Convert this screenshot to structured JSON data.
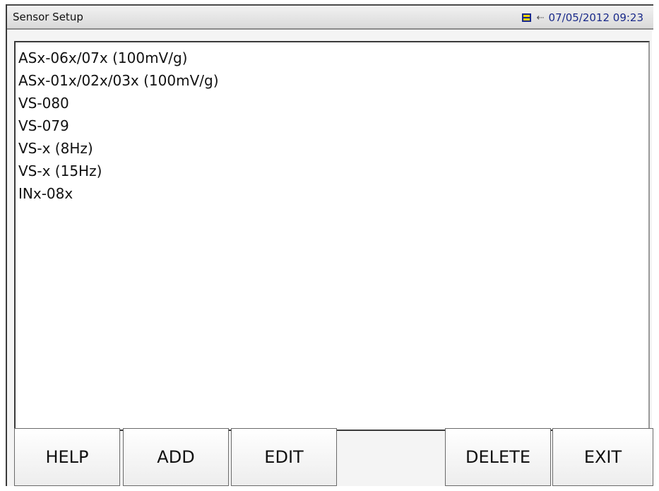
{
  "window": {
    "title": "Sensor Setup",
    "datetime": "07/05/2012 09:23",
    "battery_icon": "battery-icon",
    "usb_icon": "usb-icon"
  },
  "sensors": [
    {
      "label": "ASx-06x/07x (100mV/g)"
    },
    {
      "label": "ASx-01x/02x/03x (100mV/g)"
    },
    {
      "label": "VS-080"
    },
    {
      "label": "VS-079"
    },
    {
      "label": "VS-x (8Hz)"
    },
    {
      "label": "VS-x (15Hz)"
    },
    {
      "label": "INx-08x"
    }
  ],
  "buttons": {
    "help": "HELP",
    "add": "ADD",
    "edit": "EDIT",
    "delete": "DELETE",
    "exit": "EXIT"
  },
  "colors": {
    "datetime": "#1a2a8a",
    "battery_fill": "#f2d200"
  }
}
